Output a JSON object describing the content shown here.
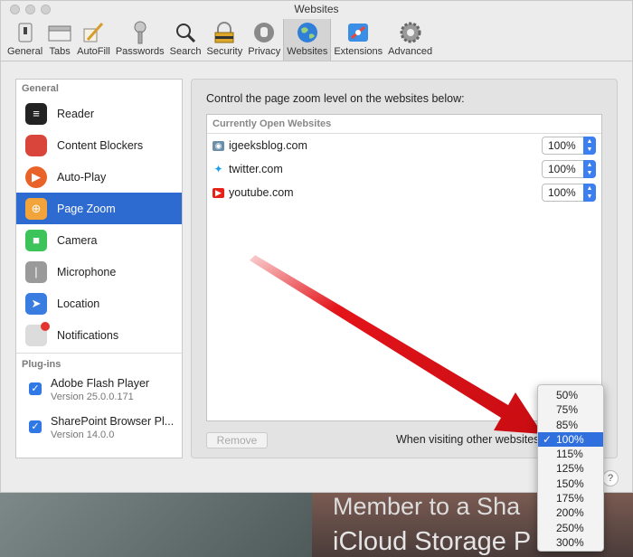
{
  "window": {
    "title": "Websites"
  },
  "toolbar": {
    "items": [
      {
        "label": "General",
        "icon": "general-icon"
      },
      {
        "label": "Tabs",
        "icon": "tabs-icon"
      },
      {
        "label": "AutoFill",
        "icon": "autofill-icon"
      },
      {
        "label": "Passwords",
        "icon": "passwords-icon"
      },
      {
        "label": "Search",
        "icon": "search-icon"
      },
      {
        "label": "Security",
        "icon": "security-icon"
      },
      {
        "label": "Privacy",
        "icon": "privacy-icon"
      },
      {
        "label": "Websites",
        "icon": "websites-icon",
        "active": true
      },
      {
        "label": "Extensions",
        "icon": "extensions-icon"
      },
      {
        "label": "Advanced",
        "icon": "advanced-icon"
      }
    ]
  },
  "sidebar": {
    "general_header": "General",
    "items": [
      {
        "label": "Reader",
        "icon": "reader-icon",
        "color": "#222222"
      },
      {
        "label": "Content Blockers",
        "icon": "content-blockers-icon",
        "color": "#d9453b"
      },
      {
        "label": "Auto-Play",
        "icon": "auto-play-icon",
        "color": "#e8622a"
      },
      {
        "label": "Page Zoom",
        "icon": "page-zoom-icon",
        "color": "#f2a33a",
        "selected": true
      },
      {
        "label": "Camera",
        "icon": "camera-icon",
        "color": "#3cc35a"
      },
      {
        "label": "Microphone",
        "icon": "microphone-icon",
        "color": "#9a9a9a"
      },
      {
        "label": "Location",
        "icon": "location-icon",
        "color": "#3a7de0"
      },
      {
        "label": "Notifications",
        "icon": "notifications-icon",
        "color": "#cfcfcf"
      }
    ],
    "plugins_header": "Plug-ins",
    "plugins": [
      {
        "name": "Adobe Flash Player",
        "version": "Version 25.0.0.171",
        "checked": true
      },
      {
        "name": "SharePoint Browser Pl...",
        "version": "Version 14.0.0",
        "checked": true
      }
    ]
  },
  "main": {
    "description": "Control the page zoom level on the websites below:",
    "list_header": "Currently Open Websites",
    "sites": [
      {
        "domain": "igeeksblog.com",
        "zoom": "100%",
        "icon": "igeeksblog-favicon",
        "color": "#6b8fa8"
      },
      {
        "domain": "twitter.com",
        "zoom": "100%",
        "icon": "twitter-favicon",
        "color": "#1da1f2"
      },
      {
        "domain": "youtube.com",
        "zoom": "100%",
        "icon": "youtube-favicon",
        "color": "#e62117"
      }
    ],
    "remove_label": "Remove",
    "other_label": "When visiting other websites"
  },
  "zoom_menu": {
    "options": [
      "50%",
      "75%",
      "85%",
      "100%",
      "115%",
      "125%",
      "150%",
      "175%",
      "200%",
      "250%",
      "300%"
    ],
    "selected": "100%",
    "check": "✓"
  },
  "help": {
    "label": "?"
  },
  "background": {
    "line1": "Member to a Sha",
    "line2": "iCloud Storage P"
  },
  "colors": {
    "accent": "#2e6bd0",
    "arrow": "#e3141a"
  }
}
